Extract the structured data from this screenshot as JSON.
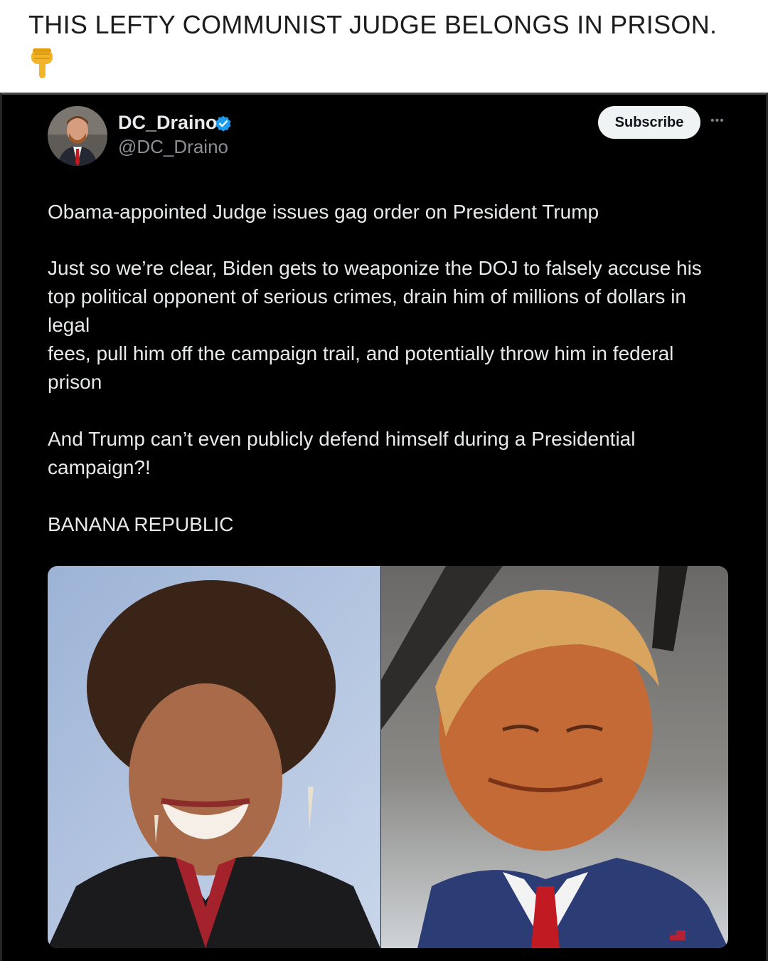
{
  "caption": {
    "text": "THIS LEFTY COMMUNIST JUDGE BELONGS IN PRISON.",
    "emoji_icon": "backhand-index-pointing-down-icon"
  },
  "tweet": {
    "author": {
      "display_name": "DC_Draino",
      "handle": "@DC_Draino",
      "verified_icon": "verified-badge-icon",
      "verified_color": "#1d9bf0"
    },
    "subscribe_label": "Subscribe",
    "more_icon": "more-options-icon",
    "paragraphs": [
      "Obama-appointed Judge issues gag order on President Trump",
      "Just so we’re clear, Biden gets to weaponize the DOJ to falsely accuse his top political opponent of serious crimes, drain him of millions of dollars in legal",
      "fees, pull him off the campaign trail, and potentially throw him in federal prison",
      "And Trump can’t even publicly defend himself during a Presidential campaign?!",
      "BANANA REPUBLIC"
    ]
  },
  "colors": {
    "tweet_background": "#000000",
    "text": "#e7e9ea",
    "handle": "#8b8f94"
  }
}
